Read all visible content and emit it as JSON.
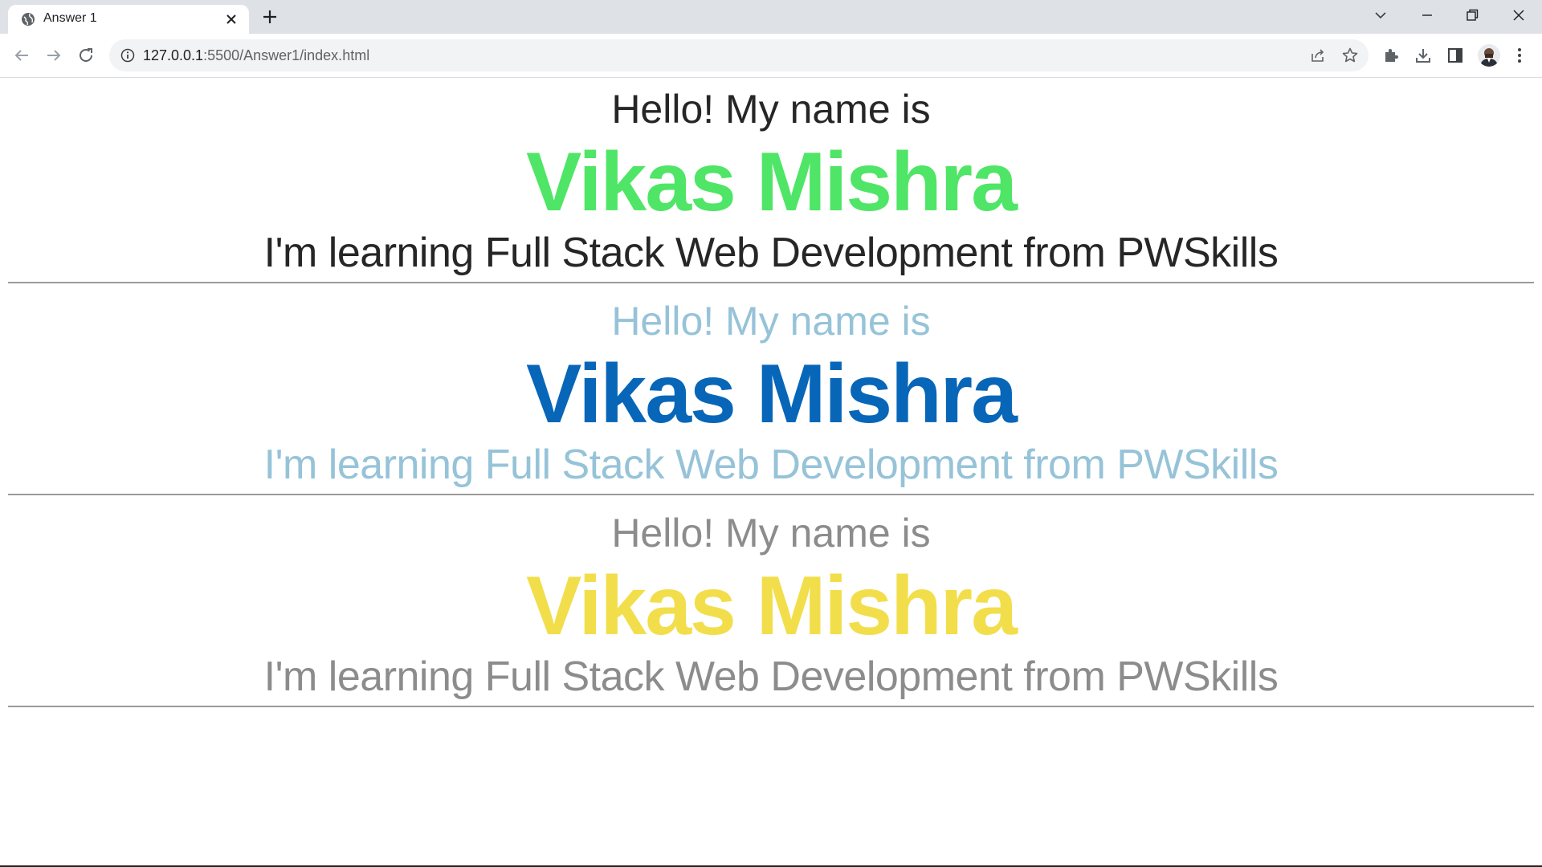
{
  "browser": {
    "tab_title": "Answer 1",
    "url_host": "127.0.0.1",
    "url_rest": ":5500/Answer1/index.html"
  },
  "sections": [
    {
      "greeting": "Hello! My name is",
      "name": "Vikas Mishra",
      "tagline": "I'm learning Full Stack Web Development from PWSkills",
      "colors": {
        "greeting": "#262626",
        "name": "#4fe566",
        "tagline": "#262626"
      }
    },
    {
      "greeting": "Hello! My name is",
      "name": "Vikas Mishra",
      "tagline": "I'm learning Full Stack Web Development from PWSkills",
      "colors": {
        "greeting": "#96c3d8",
        "name": "#0766b8",
        "tagline": "#96c3d8"
      }
    },
    {
      "greeting": "Hello! My name is",
      "name": "Vikas Mishra",
      "tagline": "I'm learning Full Stack Web Development from PWSkills",
      "colors": {
        "greeting": "#8c8c8c",
        "name": "#f2de4b",
        "tagline": "#8c8c8c"
      }
    }
  ]
}
